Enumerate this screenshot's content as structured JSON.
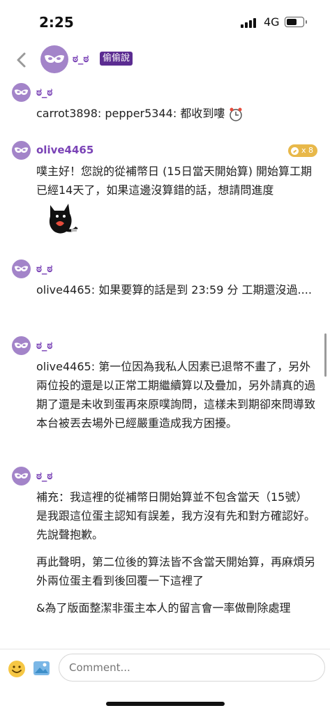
{
  "status_bar": {
    "time": "2:25",
    "network": "4G"
  },
  "header": {
    "name": "ಠ_ಠ",
    "badge": "偷偷說",
    "back_icon": "chevron-left-icon",
    "avatar_icon": "mask-icon"
  },
  "posts": [
    {
      "name": "ಠ_ಠ",
      "paragraphs": [
        "carrot3898: pepper5344: 都收到嘍"
      ]
    },
    {
      "name": "olive4465",
      "karma": "x 8",
      "paragraphs": [
        "噗主好！您說的從補幣日 (15日當天開始算) 開始算工期已經14天了，如果這邊沒算錯的話，想請問進度"
      ]
    },
    {
      "name": "ಠ_ಠ",
      "paragraphs": [
        "olive4465: 如果要算的話是到 23:59 分 工期還沒過...."
      ]
    },
    {
      "name": "ಠ_ಠ",
      "paragraphs": [
        "olive4465: 第一位因為我私人因素已退幣不畫了，另外兩位投的還是以正常工期繼續算以及疊加，另外請真的過期了還是未收到蛋再來原噗詢問，這樣未到期卻來問導致本台被丟去場外已經嚴重造成我方困擾。"
      ]
    },
    {
      "name": "ಠ_ಠ",
      "paragraphs": [
        "補充：我這裡的從補幣日開始算並不包含當天（15號）\n是我跟這位蛋主認知有誤差，我方沒有先和對方確認好。先說聲抱歉。",
        "再此聲明，第二位後的算法皆不含當天開始算，再麻煩另外兩位蛋主看到後回覆一下這裡了",
        "&為了版面整潔非蛋主本人的留言會一率做刪除處理"
      ]
    }
  ],
  "composer": {
    "placeholder": "Comment...",
    "emoji_icon": "smiley-icon",
    "image_icon": "image-icon"
  },
  "colors": {
    "accent": "#7a43b6",
    "badge_bg": "#5b2c91",
    "avatar_bg": "#a384c9",
    "karma_bg": "#e8b84a"
  }
}
